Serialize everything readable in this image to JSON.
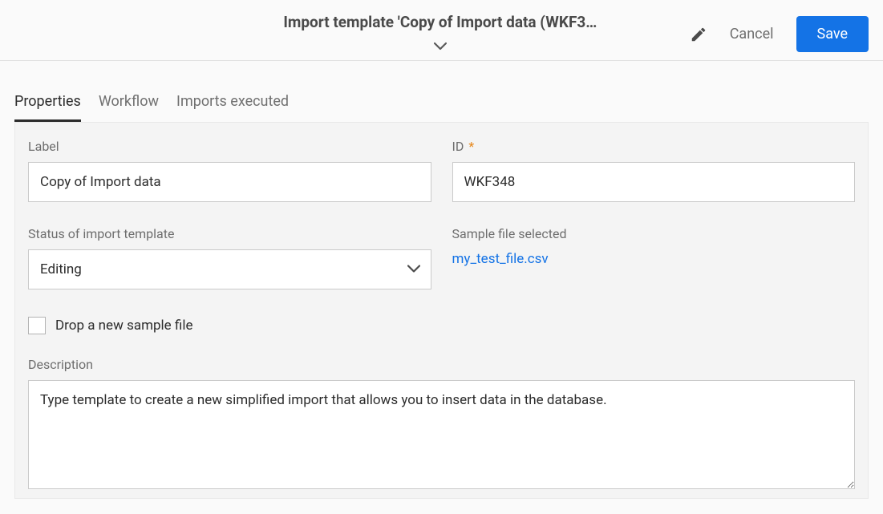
{
  "header": {
    "title": "Import template 'Copy of Import data (WKF3…",
    "cancel_label": "Cancel",
    "save_label": "Save"
  },
  "tabs": {
    "items": [
      {
        "label": "Properties",
        "active": true
      },
      {
        "label": "Workflow",
        "active": false
      },
      {
        "label": "Imports executed",
        "active": false
      }
    ]
  },
  "form": {
    "label_field": {
      "label": "Label",
      "value": "Copy of Import data"
    },
    "id_field": {
      "label": "ID",
      "value": "WKF348",
      "required_mark": "*"
    },
    "status_field": {
      "label": "Status of import template",
      "value": "Editing"
    },
    "sample_file": {
      "label": "Sample file selected",
      "filename": "my_test_file.csv"
    },
    "drop_checkbox": {
      "label": "Drop a new sample file",
      "checked": false
    },
    "description": {
      "label": "Description",
      "value": "Type template to create a new simplified import that allows you to insert data in the database."
    }
  }
}
